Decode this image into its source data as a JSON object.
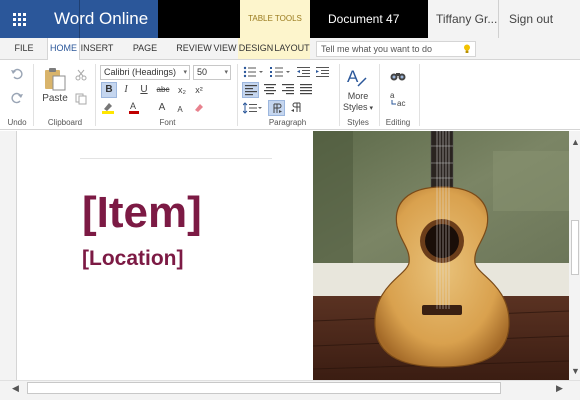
{
  "titlebar": {
    "app_name": "Word Online",
    "contextual_tab_group": "TABLE TOOLS",
    "document_name": "Document 47",
    "user_name": "Tiffany Gr...",
    "sign_out": "Sign out"
  },
  "tabs": [
    "FILE",
    "HOME",
    "INSERT",
    "PAGE LAYOUT",
    "REVIEW",
    "VIEW",
    "DESIGN",
    "LAYOUT"
  ],
  "active_tab": "HOME",
  "tell_me": {
    "placeholder": "Tell me what you want to do"
  },
  "ribbon": {
    "undo_group_label": "Undo",
    "clipboard": {
      "paste_label": "Paste",
      "group_label": "Clipboard"
    },
    "font": {
      "font_name": "Calibri (Headings)",
      "font_size": "50",
      "bold": "B",
      "italic": "I",
      "underline": "U",
      "strikethrough": "abc",
      "subscript": "x₂",
      "superscript": "x²",
      "grow": "A",
      "shrink": "A",
      "group_label": "Font"
    },
    "paragraph": {
      "group_label": "Paragraph"
    },
    "styles": {
      "more_label": "More",
      "styles_label": "Styles",
      "group_label": "Styles"
    },
    "editing": {
      "group_label": "Editing"
    }
  },
  "document": {
    "title": "[Item]",
    "subtitle": "[Location]"
  },
  "colors": {
    "brand": "#2b579a",
    "heading": "#7c1a44",
    "contextual": "#fdf5cc"
  },
  "icons": [
    "grid-icon",
    "undo-icon",
    "redo-icon",
    "paste-icon",
    "cut-icon",
    "copy-icon",
    "format-painter-icon",
    "highlight-icon",
    "font-color-icon",
    "clear-format-icon",
    "bullets-icon",
    "numbering-icon",
    "outdent-icon",
    "indent-icon",
    "align-left-icon",
    "align-center-icon",
    "align-right-icon",
    "justify-icon",
    "line-spacing-icon",
    "ltr-icon",
    "rtl-icon",
    "styles-icon",
    "find-icon",
    "replace-icon",
    "lightbulb-icon"
  ]
}
